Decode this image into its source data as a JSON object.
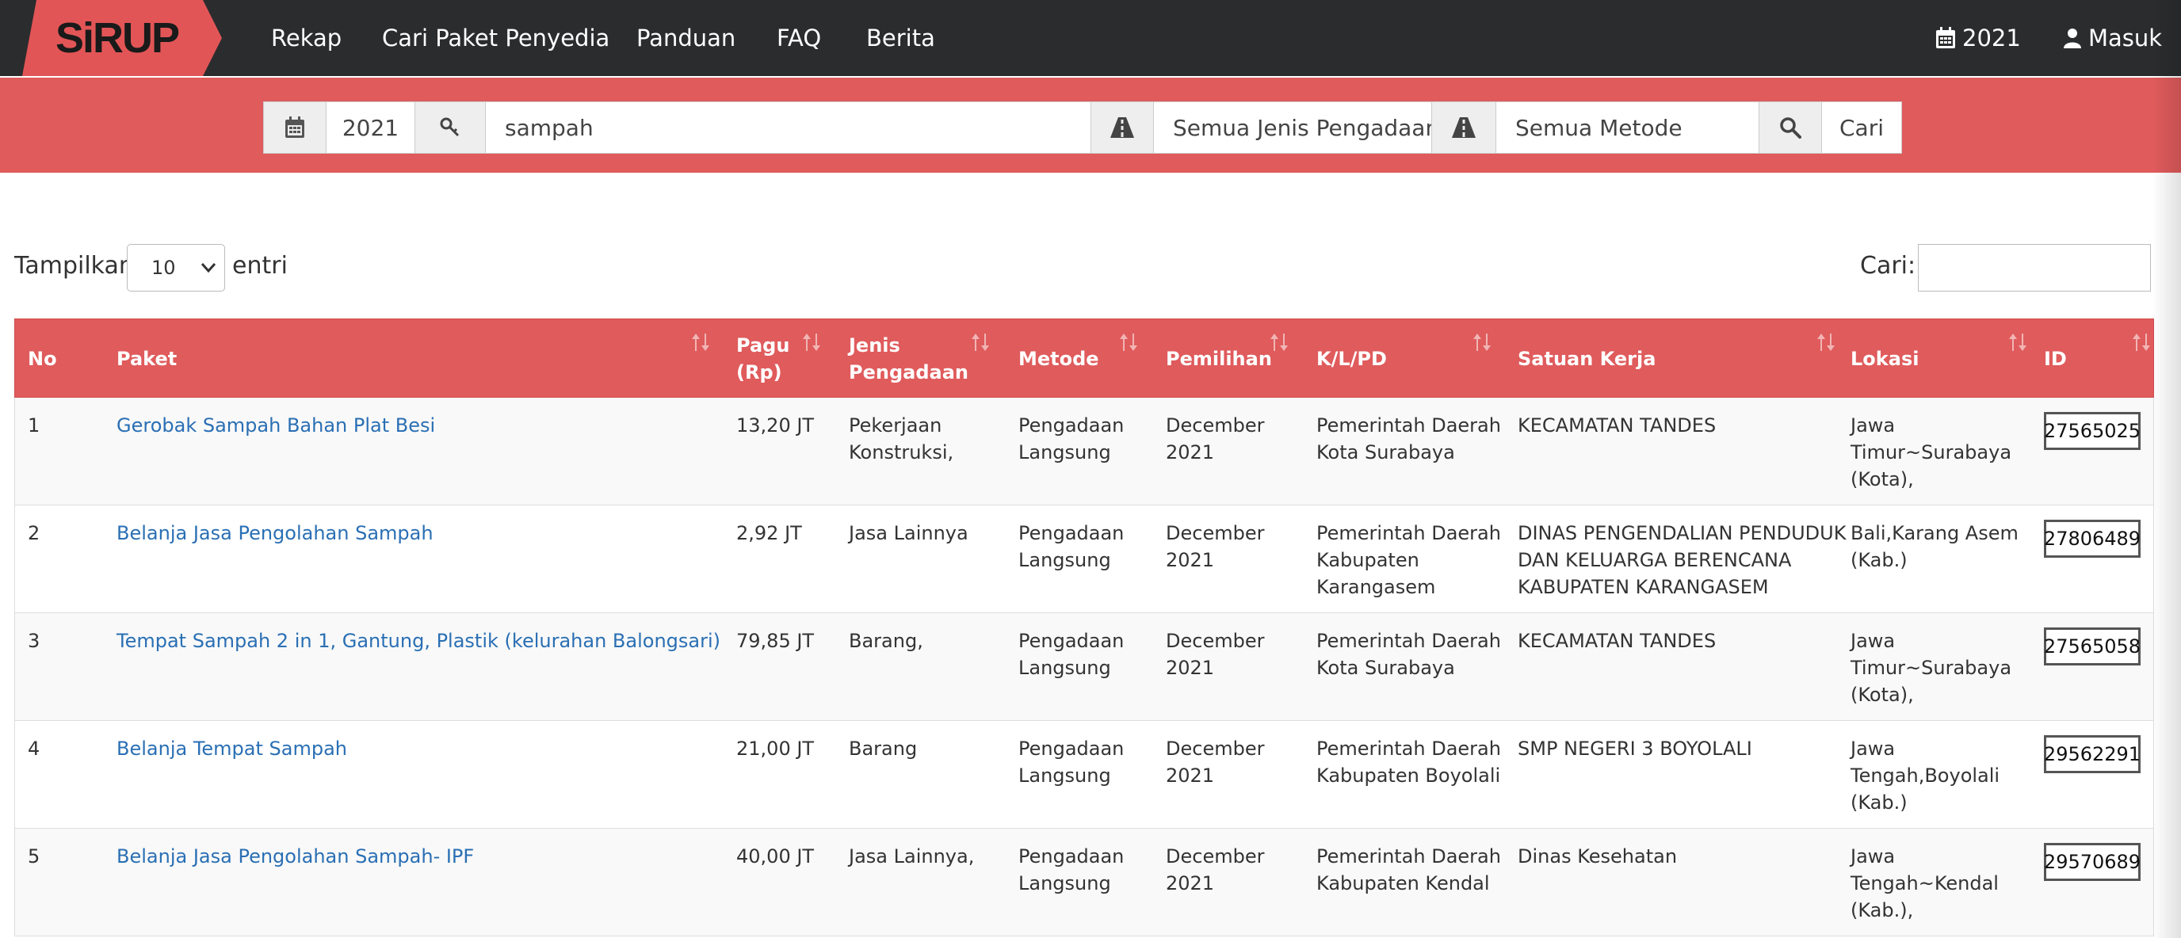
{
  "navbar": {
    "logo_text": "SiRUP",
    "links": [
      "Rekap",
      "Cari Paket Penyedia",
      "Panduan",
      "FAQ",
      "Berita"
    ],
    "year": "2021",
    "login": "Masuk"
  },
  "search": {
    "year": "2021",
    "keyword": "sampah",
    "jenis": "Semua Jenis Pengadaan",
    "metode": "Semua Metode",
    "button": "Cari"
  },
  "controls": {
    "show_label": "Tampilkan",
    "page_length": "10",
    "entries_label": "entri",
    "filter_label": "Cari:"
  },
  "table": {
    "headers": {
      "no": "No",
      "paket": "Paket",
      "pagu_1": "Pagu",
      "pagu_2": "(Rp)",
      "jenis_1": "Jenis",
      "jenis_2": "Pengadaan",
      "metode": "Metode",
      "pemilihan": "Pemilihan",
      "klpd": "K/L/PD",
      "satuan": "Satuan Kerja",
      "lokasi": "Lokasi",
      "id": "ID"
    },
    "rows": [
      {
        "no": "1",
        "paket": "Gerobak Sampah Bahan Plat Besi",
        "pagu": "13,20 JT",
        "jenis": [
          "Pekerjaan",
          "Konstruksi,"
        ],
        "metode": [
          "Pengadaan",
          "Langsung"
        ],
        "pemilihan": [
          "December",
          "2021"
        ],
        "klpd": [
          "Pemerintah Daerah",
          "Kota Surabaya"
        ],
        "satuan": [
          "KECAMATAN TANDES"
        ],
        "lokasi": [
          "Jawa",
          "Timur~Surabaya",
          "(Kota),"
        ],
        "id": "27565025"
      },
      {
        "no": "2",
        "paket": "Belanja Jasa Pengolahan Sampah",
        "pagu": "2,92 JT",
        "jenis": [
          "Jasa Lainnya"
        ],
        "metode": [
          "Pengadaan",
          "Langsung"
        ],
        "pemilihan": [
          "December",
          "2021"
        ],
        "klpd": [
          "Pemerintah Daerah",
          "Kabupaten",
          "Karangasem"
        ],
        "satuan": [
          "DINAS PENGENDALIAN PENDUDUK",
          "DAN KELUARGA BERENCANA",
          "KABUPATEN KARANGASEM"
        ],
        "lokasi": [
          "Bali,Karang Asem",
          "(Kab.)"
        ],
        "id": "27806489"
      },
      {
        "no": "3",
        "paket": "Tempat Sampah 2 in 1, Gantung, Plastik (kelurahan Balongsari)",
        "pagu": "79,85 JT",
        "jenis": [
          "Barang,"
        ],
        "metode": [
          "Pengadaan",
          "Langsung"
        ],
        "pemilihan": [
          "December",
          "2021"
        ],
        "klpd": [
          "Pemerintah Daerah",
          "Kota Surabaya"
        ],
        "satuan": [
          "KECAMATAN TANDES"
        ],
        "lokasi": [
          "Jawa",
          "Timur~Surabaya",
          "(Kota),"
        ],
        "id": "27565058"
      },
      {
        "no": "4",
        "paket": "Belanja Tempat Sampah",
        "pagu": "21,00 JT",
        "jenis": [
          "Barang"
        ],
        "metode": [
          "Pengadaan",
          "Langsung"
        ],
        "pemilihan": [
          "December",
          "2021"
        ],
        "klpd": [
          "Pemerintah Daerah",
          "Kabupaten Boyolali"
        ],
        "satuan": [
          "SMP NEGERI 3 BOYOLALI"
        ],
        "lokasi": [
          "Jawa",
          "Tengah,Boyolali",
          "(Kab.)"
        ],
        "id": "29562291"
      },
      {
        "no": "5",
        "paket": "Belanja Jasa Pengolahan Sampah- IPF",
        "pagu": "40,00 JT",
        "jenis": [
          "Jasa Lainnya,"
        ],
        "metode": [
          "Pengadaan",
          "Langsung"
        ],
        "pemilihan": [
          "December",
          "2021"
        ],
        "klpd": [
          "Pemerintah Daerah",
          "Kabupaten Kendal"
        ],
        "satuan": [
          "Dinas Kesehatan"
        ],
        "lokasi": [
          "Jawa",
          "Tengah~Kendal",
          "(Kab.),"
        ],
        "id": "29570689"
      }
    ]
  }
}
